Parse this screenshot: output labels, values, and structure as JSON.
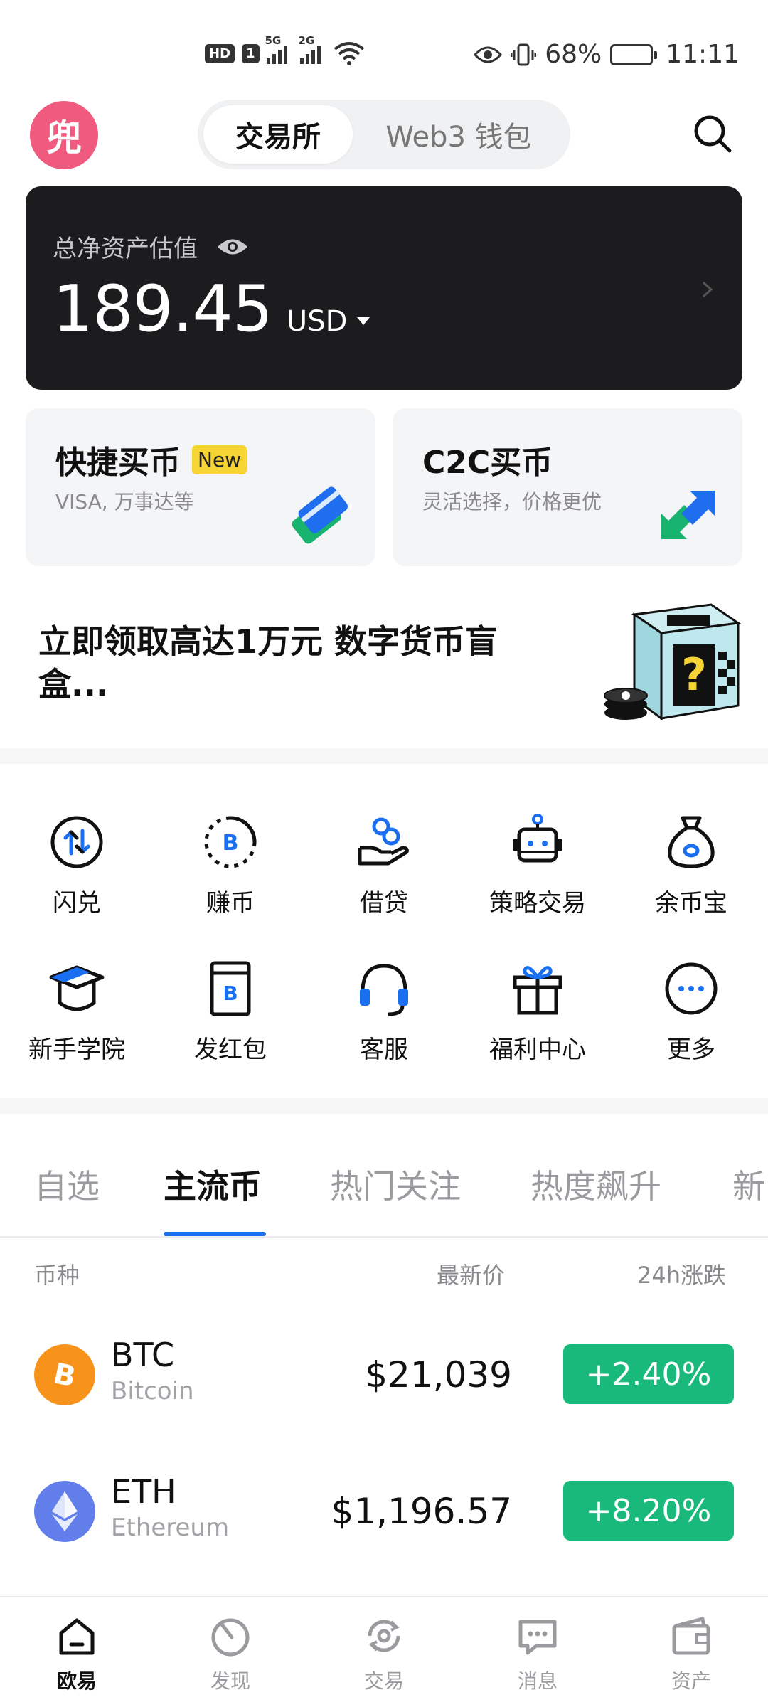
{
  "status_bar": {
    "hd": "HD",
    "sim": "1",
    "net1": "5G",
    "net2": "2G",
    "battery": "68%",
    "battery_level": 0.68,
    "time": "11:11"
  },
  "header": {
    "avatar_char": "兜",
    "tabs": [
      "交易所",
      "Web3 钱包"
    ],
    "active_tab": 0
  },
  "asset": {
    "label": "总净资产估值",
    "amount": "189.45",
    "currency": "USD"
  },
  "buy_cards": [
    {
      "title": "快捷买币",
      "badge": "New",
      "subtitle": "VISA, 万事达等"
    },
    {
      "title": "C2C买币",
      "subtitle": "灵活选择，价格更优"
    }
  ],
  "promo": {
    "text": "立即领取高达1万元 数字货币盲盒..."
  },
  "grid": [
    {
      "label": "闪兑",
      "icon": "swap-icon"
    },
    {
      "label": "赚币",
      "icon": "earn-icon"
    },
    {
      "label": "借贷",
      "icon": "loan-icon"
    },
    {
      "label": "策略交易",
      "icon": "robot-icon"
    },
    {
      "label": "余币宝",
      "icon": "money-bag-icon"
    },
    {
      "label": "新手学院",
      "icon": "graduation-cap-icon"
    },
    {
      "label": "发红包",
      "icon": "red-packet-icon"
    },
    {
      "label": "客服",
      "icon": "headset-icon"
    },
    {
      "label": "福利中心",
      "icon": "gift-icon"
    },
    {
      "label": "更多",
      "icon": "more-icon"
    }
  ],
  "market": {
    "tabs": [
      "自选",
      "主流币",
      "热门关注",
      "热度飙升",
      "新"
    ],
    "active_tab": 1,
    "columns": [
      "币种",
      "最新价",
      "24h涨跌"
    ],
    "rows": [
      {
        "symbol": "BTC",
        "name": "Bitcoin",
        "price": "$21,039",
        "change": "+2.40%"
      },
      {
        "symbol": "ETH",
        "name": "Ethereum",
        "price": "$1,196.57",
        "change": "+8.20%"
      }
    ]
  },
  "nav": [
    {
      "label": "欧易",
      "icon": "home-icon"
    },
    {
      "label": "发现",
      "icon": "discover-icon"
    },
    {
      "label": "交易",
      "icon": "trade-icon"
    },
    {
      "label": "消息",
      "icon": "message-icon"
    },
    {
      "label": "资产",
      "icon": "wallet-icon"
    }
  ],
  "colors": {
    "accent_blue": "#1a6ff0",
    "up_green": "#18b97a",
    "btc_orange": "#f7931a",
    "eth_blue": "#627eea",
    "avatar_pink": "#ef5a7e",
    "card_dark": "#1c1c1e"
  }
}
